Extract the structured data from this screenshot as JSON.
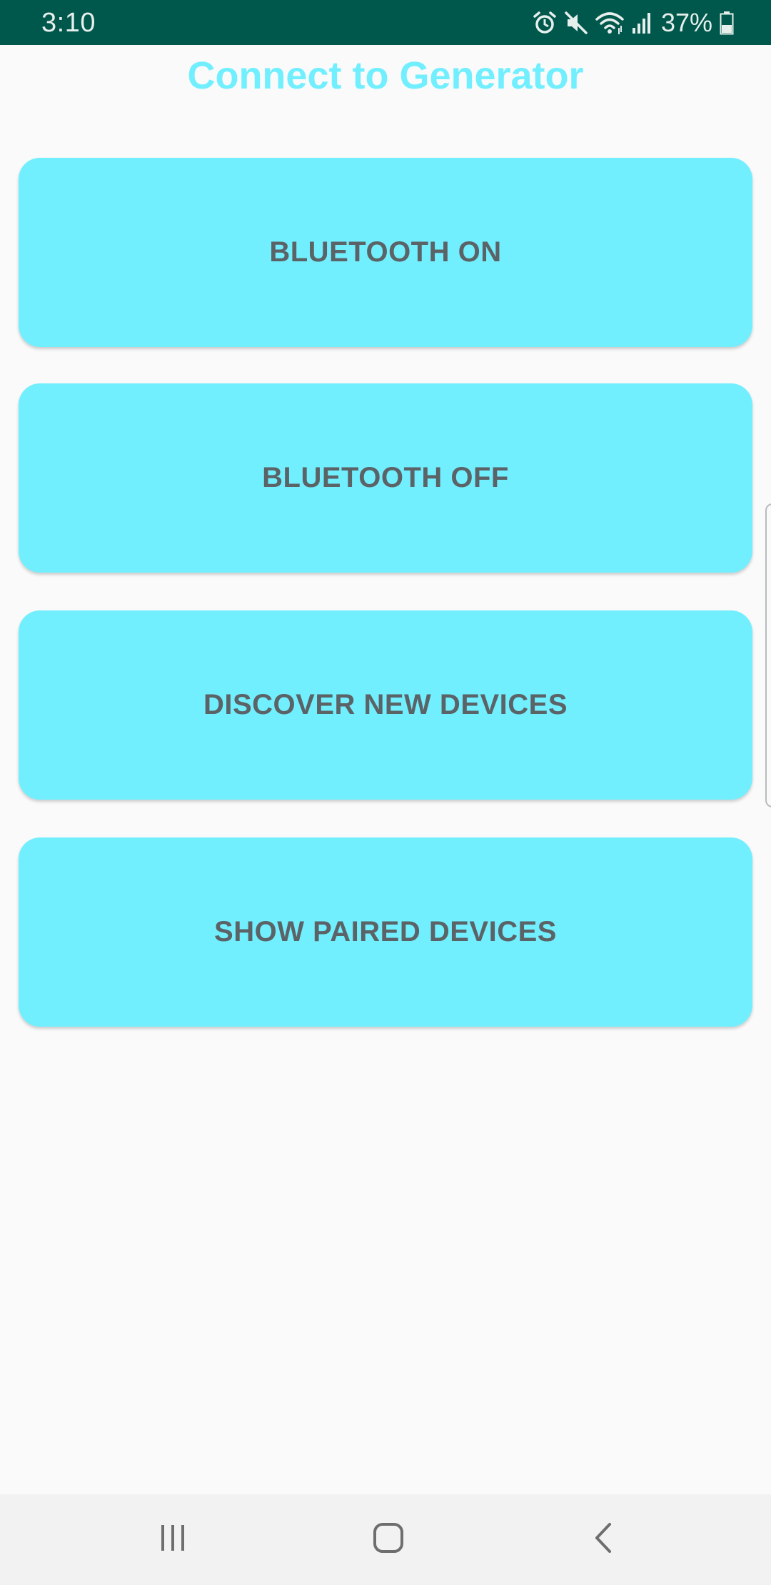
{
  "status_bar": {
    "time": "3:10",
    "battery_percent": "37%",
    "icons": [
      "alarm-icon",
      "mute-icon",
      "wifi-icon",
      "signal-icon",
      "battery-icon"
    ]
  },
  "app": {
    "title": "Connect to Generator"
  },
  "buttons": {
    "bluetooth_on": "BLUETOOTH ON",
    "bluetooth_off": "BLUETOOTH OFF",
    "discover": "DISCOVER NEW DEVICES",
    "show_paired": "SHOW PAIRED DEVICES"
  },
  "nav_bar": {
    "icons": [
      "recents-icon",
      "home-icon",
      "back-icon"
    ]
  },
  "colors": {
    "status_bar": "#00574b",
    "accent": "#72efff",
    "button_text": "#5b6367",
    "background": "#fafafa"
  }
}
